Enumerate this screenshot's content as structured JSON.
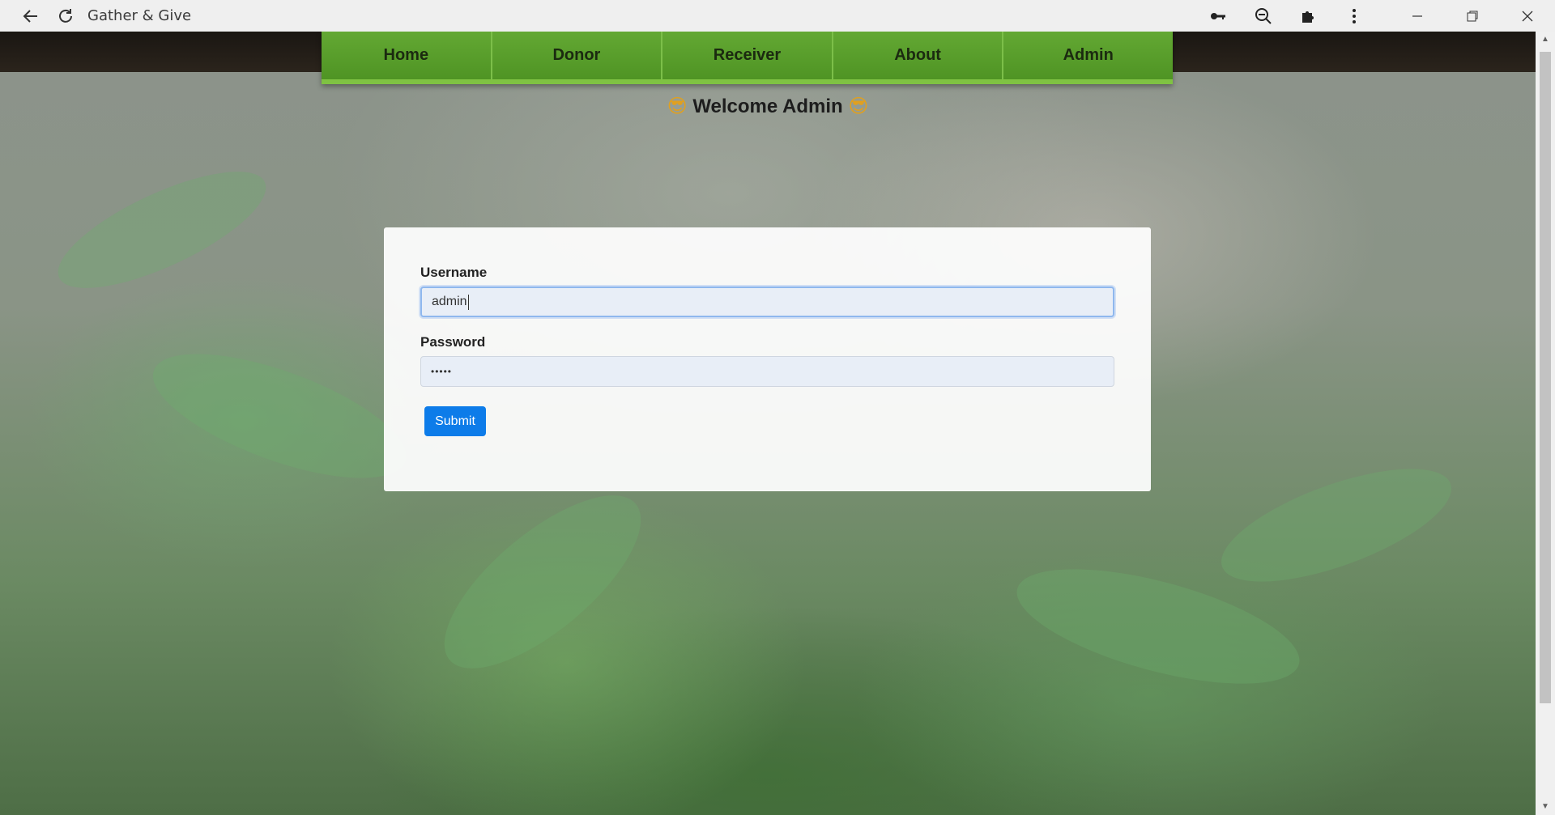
{
  "browser": {
    "title": "Gather & Give",
    "icons": [
      "back-arrow-icon",
      "reload-icon",
      "key-icon",
      "zoom-out-icon",
      "extensions-icon",
      "more-vert-icon",
      "minimize-icon",
      "restore-icon",
      "close-icon"
    ]
  },
  "nav": {
    "items": [
      {
        "label": "Home"
      },
      {
        "label": "Donor"
      },
      {
        "label": "Receiver"
      },
      {
        "label": "About"
      },
      {
        "label": "Admin"
      }
    ]
  },
  "welcome": {
    "text": "Welcome Admin",
    "emoji": "😎"
  },
  "form": {
    "username_label": "Username",
    "username_value": "admin",
    "password_label": "Password",
    "password_value": "•••••",
    "submit_label": "Submit"
  },
  "colors": {
    "nav_green": "#5a9e2c",
    "submit_blue": "#0d7ce9"
  }
}
